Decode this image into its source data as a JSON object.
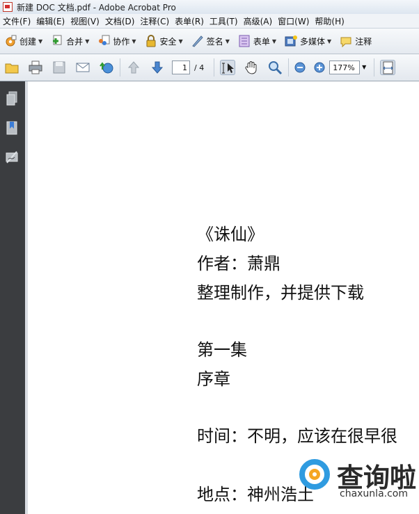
{
  "window": {
    "title": "新建 DOC 文档.pdf - Adobe Acrobat Pro"
  },
  "menu": [
    "文件(F)",
    "编辑(E)",
    "视图(V)",
    "文档(D)",
    "注释(C)",
    "表单(R)",
    "工具(T)",
    "高级(A)",
    "窗口(W)",
    "帮助(H)"
  ],
  "toolbar": {
    "create": "创建",
    "combine": "合并",
    "collaborate": "协作",
    "secure": "安全",
    "sign": "签名",
    "forms": "表单",
    "multimedia": "多媒体",
    "comment": "注释"
  },
  "nav": {
    "page_current": "1",
    "page_total": "/ 4",
    "zoom": "177%"
  },
  "document": {
    "lines": [
      "《诛仙》",
      "作者：萧鼎",
      "整理制作，并提供下载",
      "第一集",
      "序章",
      "时间：不明，应该在很早很",
      "地点：神州浩土"
    ]
  },
  "watermark": {
    "title": "查询啦",
    "sub": "chaxunla.com"
  },
  "colors": {
    "accent": "#2f9be0",
    "accent2": "#f5a623",
    "panel": "#3b3d40"
  }
}
